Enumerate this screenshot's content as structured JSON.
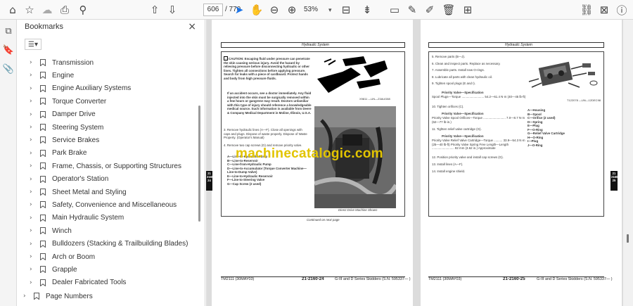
{
  "toolbar": {
    "page_current": "606",
    "page_total": "/ 770",
    "zoom": "53%"
  },
  "bookmarks_panel": {
    "title": "Bookmarks",
    "close": "×",
    "items": [
      "Transmission",
      "Engine",
      "Engine Auxiliary Systems",
      "Torque Converter",
      "Damper Drive",
      "Steering System",
      "Service Brakes",
      "Park Brake",
      "Frame, Chassis, or Supporting Structures",
      "Operator's Station",
      "Sheet Metal and Styling",
      "Safety, Convenience and Miscellaneous",
      "Main Hydraulic System",
      "Winch",
      "Bulldozers (Stacking & Trailbuilding Blades)",
      "Arch or Boom",
      "Grapple",
      "Dealer Fabricated Tools"
    ],
    "last_item": "Page Numbers"
  },
  "left_page": {
    "header": "Hydraulic System",
    "caution": "CAUTION: Escaping fluid under pressure can penetrate the skin causing serious injury. Avoid the hazard by relieving pressure before disconnecting hydraulic or other lines. Tighten all connections before applying pressure. Search for leaks with a piece of cardboard. Protect hands and body from high pressure fluids.",
    "accident": "If an accident occurs, see a doctor immediately. Any fluid injected into the skin must be surgically removed within a few hours or gangrene may result. Doctors unfamiliar with this type of injury should reference a knowledgeable medical source. Such information is available from Deere & Company Medical Department in Moline, Illinois, U.S.A.",
    "step3": "3. Remove hydraulic lines (A—F). Close all openings with caps and plugs. Dispose of waste properly. Dispose of Waste Property. (Operator's Manual)",
    "step4": "4. Remove two cap screws (G) and remove priority valve.",
    "legend": [
      "A—Line-to-Hydraulic Pump",
      "B—Line-to-Reservoir",
      "C—Line-from-Hydraulic Pump",
      "D—Line-to-Accumulator (Torque Converter Machine—Line-to-Dump Valve)",
      "E—Line-to-Hydraulic Reservoir",
      "F—Line-to-Steering Valve",
      "G—Cap Screw (2 used)"
    ],
    "photo_caption": "Direct Drive Machine Shown",
    "continued": "Continued on next page",
    "footer_left": "TM2111 (30MAY03)",
    "footer_num": "21-2160-24",
    "footer_right": "G-III and D Series Skidders (S.N. 595337— )",
    "tab": "21\n2160\n24"
  },
  "right_page": {
    "header": "Hydraulic System",
    "steps": [
      "5. Remove parts (B—J).",
      "6. Clean and inspect parts. Replace as necessary.",
      "7. Assemble parts. Install new O-rings.",
      "8. Lubricate all parts with clean hydraulic oil.",
      "9. Tighten spool plugs (E and I)."
    ],
    "spec1_title": "Priority Valve—Specification",
    "spec1_line": "Spool Plugs—Torque .......................... 54.2—61.4 N·m (40—45 lb-ft)",
    "step10": "10. Tighten orifices (C).",
    "spec2_title": "Priority Valve—Specification",
    "spec2_line": "Priority Valve Spool Orifices—Torque .......................... 7.0—8.7 N·m (62—77 lb-in.)",
    "step11": "11. Tighten relief valve cartridge (G).",
    "spec3_title": "Priority Valve—Specification",
    "spec3_line": "Priority Valve Relief Valve Cartridge—Torque .......... 33.9—54.3 N·m (25—40 lb-ft) Priority Valve Spring Free Length—Length .......................... 92 mm (3.62 in.) Approximate",
    "step12": "12. Position priority valve and install cap screws (G).",
    "step13": "13. Install lines (A—F).",
    "step14": "14. Install engine shield.",
    "legend": [
      "A—Housing",
      "B—Spool",
      "C—Orifice (2 used)",
      "D—Spring",
      "E—Plug",
      "F—O-Ring",
      "G—Relief Valve Cartridge",
      "H—O-Ring",
      "I—Plug",
      "J—O-Ring"
    ],
    "footer_left": "TM2111 (30MAY03)",
    "footer_num": "21-2160-25",
    "footer_right": "G-III and D Series Skidders (S.N. 595337— )",
    "tab": "21\n2160\n25"
  },
  "watermark": "machinecatalogic.com"
}
